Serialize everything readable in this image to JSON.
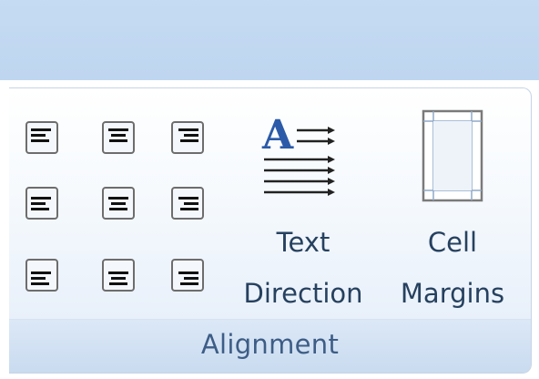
{
  "ribbon": {
    "group": {
      "caption": "Alignment",
      "align_buttons": [
        {
          "name": "align-top-left-button",
          "icon": "align-top-left-icon"
        },
        {
          "name": "align-top-center-button",
          "icon": "align-top-center-icon"
        },
        {
          "name": "align-top-right-button",
          "icon": "align-top-right-icon"
        },
        {
          "name": "align-center-left-button",
          "icon": "align-center-left-icon"
        },
        {
          "name": "align-center-button",
          "icon": "align-center-icon"
        },
        {
          "name": "align-center-right-button",
          "icon": "align-center-right-icon"
        },
        {
          "name": "align-bottom-left-button",
          "icon": "align-bottom-left-icon"
        },
        {
          "name": "align-bottom-center-button",
          "icon": "align-bottom-center-icon"
        },
        {
          "name": "align-bottom-right-button",
          "icon": "align-bottom-right-icon"
        }
      ],
      "text_direction": {
        "line1": "Text",
        "line2": "Direction",
        "icon": "text-direction-icon",
        "icon_letter": "A"
      },
      "cell_margins": {
        "line1": "Cell",
        "line2": "Margins",
        "icon": "cell-margins-icon"
      }
    }
  },
  "colors": {
    "header_band": "#c5dbf3",
    "caption_text": "#3d5d86",
    "label_text": "#26415f",
    "icon_blue": "#2b5aa8"
  }
}
